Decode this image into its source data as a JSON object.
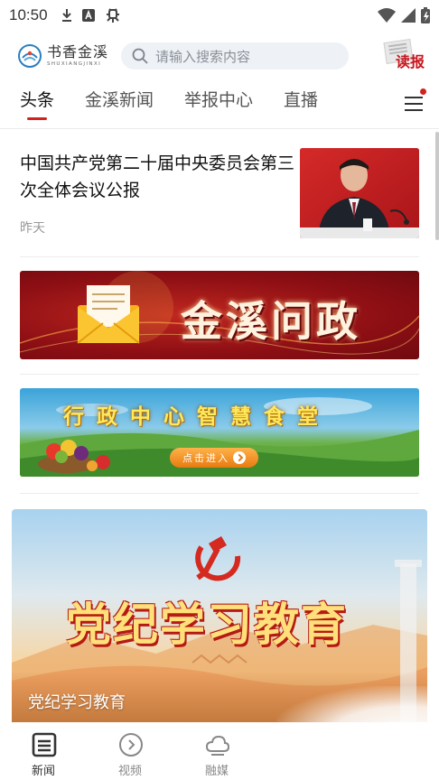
{
  "status_bar": {
    "time": "10:50",
    "left_icons": [
      "download-icon",
      "a-badge-icon",
      "bug-icon"
    ],
    "right_icons": [
      "wifi-icon",
      "signal-icon",
      "battery-charging-icon"
    ]
  },
  "header": {
    "logo_cn": "书香金溪",
    "logo_en": "SHUXIANGJINXI",
    "search_placeholder": "请输入搜索内容",
    "read_paper_label": "读报"
  },
  "tabs": [
    {
      "label": "头条",
      "active": true
    },
    {
      "label": "金溪新闻",
      "active": false
    },
    {
      "label": "举报中心",
      "active": false
    },
    {
      "label": "直播",
      "active": false
    }
  ],
  "news": [
    {
      "title": "中国共产党第二十届中央委员会第三次全体会议公报",
      "time": "昨天"
    }
  ],
  "banners": {
    "wenzheng": "金溪问政",
    "shitang_title": "行政中心智慧食堂",
    "shitang_button": "点击进入"
  },
  "feature": {
    "title": "党纪学习教育",
    "caption": "党纪学习教育"
  },
  "bottom_nav": [
    {
      "label": "新闻",
      "icon": "news-icon",
      "active": true
    },
    {
      "label": "视频",
      "icon": "play-circle-icon",
      "active": false
    },
    {
      "label": "融媒",
      "icon": "cloud-icon",
      "active": false
    }
  ],
  "colors": {
    "accent": "#d0231f",
    "search_bg": "#eef1f5"
  }
}
